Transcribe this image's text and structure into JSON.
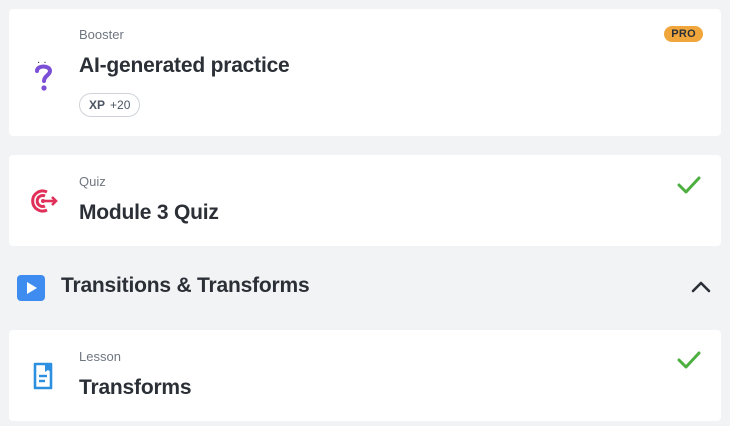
{
  "cards": [
    {
      "kind": "Booster",
      "title": "AI-generated practice",
      "badge": "PRO",
      "xp": {
        "label": "XP",
        "value": "+20"
      },
      "icon": "ai-question-icon"
    },
    {
      "kind": "Quiz",
      "title": "Module 3 Quiz",
      "status_icon": "check-icon",
      "icon": "target-icon"
    },
    {
      "kind": "Lesson",
      "title": "Transforms",
      "status_icon": "check-icon",
      "icon": "lesson-doc-icon"
    }
  ],
  "section": {
    "title": "Transitions & Transforms",
    "icon": "play-icon",
    "toggle_icon": "chevron-up-icon"
  },
  "colors": {
    "background": "#f2f3f5",
    "card": "#ffffff",
    "pro_badge": "#f0a63a",
    "check": "#4caf3f",
    "quiz_icon": "#e0305a",
    "ai_icon": "#7b4fd6",
    "lesson_icon": "#2d8fe0",
    "section_icon": "#3f8cf0"
  }
}
